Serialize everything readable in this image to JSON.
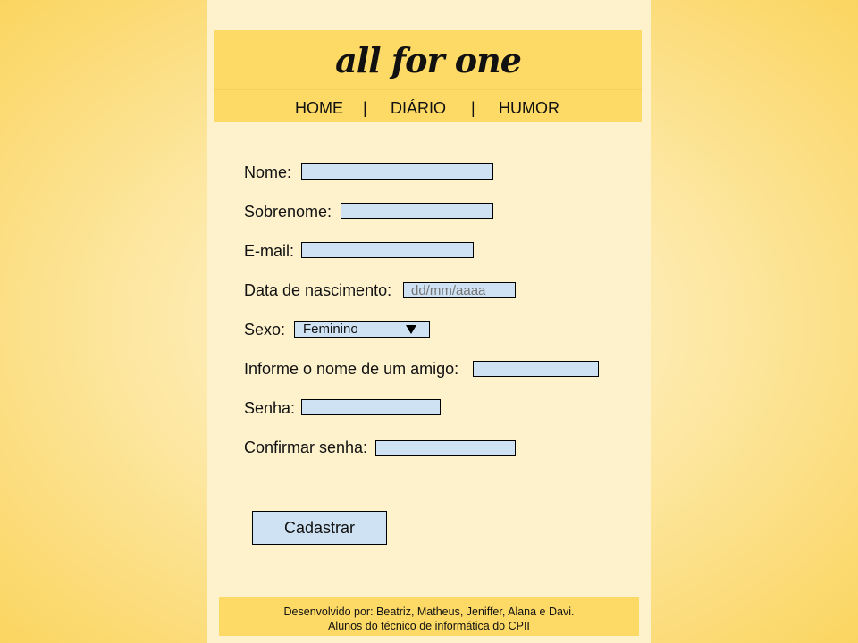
{
  "header": {
    "logo": "all for one",
    "nav": {
      "home": "HOME",
      "separator": "|",
      "diario": "DIÁRIO",
      "humor": "HUMOR"
    }
  },
  "form": {
    "nome_label": "Nome:",
    "sobrenome_label": "Sobrenome:",
    "email_label": "E-mail:",
    "nascimento_label": "Data de nascimento:",
    "nascimento_placeholder": "dd/mm/aaaa",
    "sexo_label": "Sexo:",
    "sexo_selected": "Feminino",
    "amigo_label": "Informe o nome de um amigo:",
    "senha_label": "Senha:",
    "confirmar_label": "Confirmar senha:",
    "submit_label": "Cadastrar"
  },
  "footer": {
    "line1": "Desenvolvido por: Beatriz, Matheus, Jeniffer, Alana e Davi.",
    "line2": "Alunos do técnico de informática do CPII"
  },
  "colors": {
    "page_background": "#fef2cd",
    "header_background": "#fdd966",
    "input_background": "#cfe2f3",
    "outer_background": "#fbd560"
  },
  "icons": {
    "select_caret": "triangle-down"
  }
}
